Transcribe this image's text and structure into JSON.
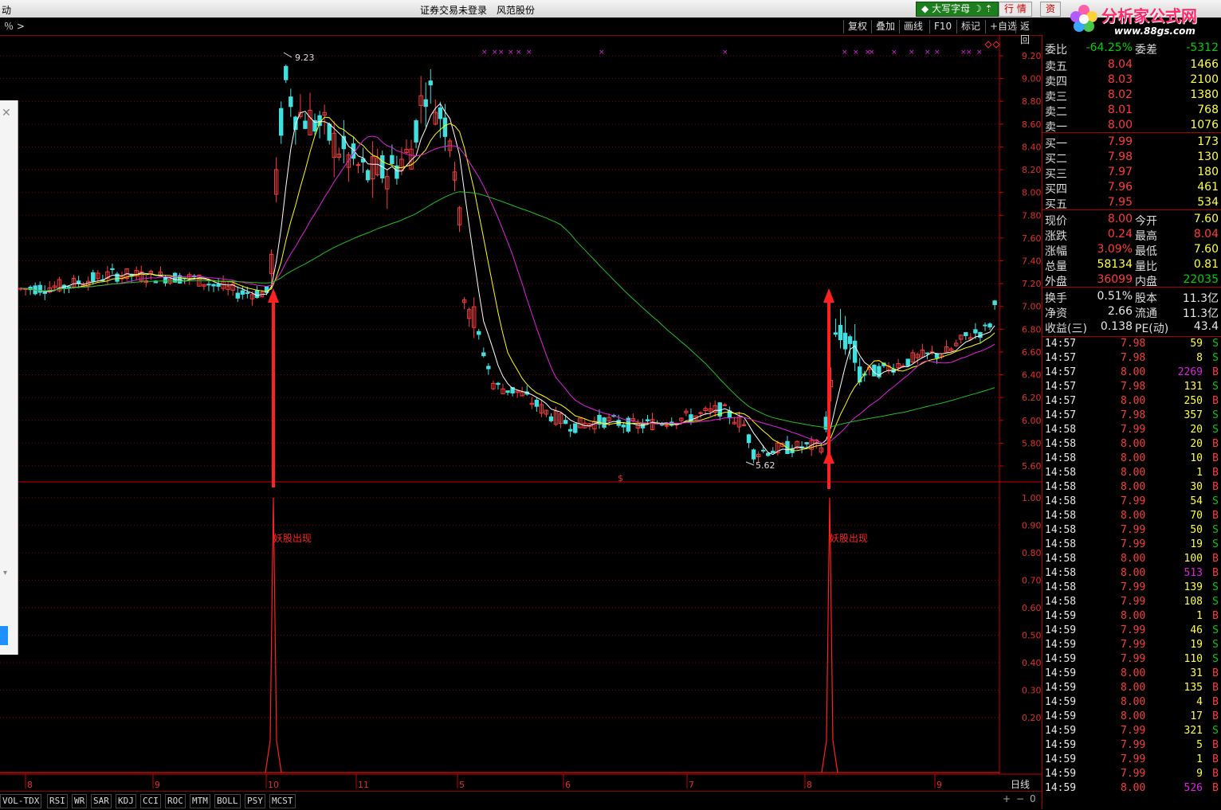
{
  "titlebar": {
    "left_text": "动",
    "center1": "证券交易未登录",
    "center2": "风范股份",
    "btn_daxie": "大写字母",
    "btn_hangqing": "行 情",
    "btn_zi": "资"
  },
  "logo": {
    "name": "分析家公式网",
    "url": "www.88gs.com"
  },
  "toolbar": {
    "left": "％ >",
    "items": [
      "复权",
      "叠加",
      "画线",
      "F10",
      "标记",
      "+自选",
      "返回"
    ]
  },
  "main": {
    "price_high_label": "9.23",
    "price_low_label": "5.62",
    "annotation_1": "妖股出现",
    "annotation_2": "妖股出现",
    "mid_marker": "$",
    "price_ticks": [
      "9.20",
      "9.00",
      "8.80",
      "8.60",
      "8.40",
      "8.20",
      "8.00",
      "7.80",
      "7.60",
      "7.40",
      "7.20",
      "7.00",
      "6.80",
      "6.60",
      "6.40",
      "6.20",
      "6.00",
      "5.80",
      "5.60"
    ],
    "ind_ticks": [
      "1.00",
      "0.90",
      "0.80",
      "0.70",
      "0.60",
      "0.50",
      "0.40",
      "0.30",
      "0.20"
    ],
    "date_labels": [
      "8",
      "9",
      "10",
      "11",
      "5",
      "6",
      "7",
      "8",
      "9"
    ],
    "period": "日线"
  },
  "quote": {
    "weibi_label": "委比",
    "weibi": "-64.25%",
    "weicha_label": "委差",
    "weicha": "-5312",
    "asks": [
      {
        "label": "卖五",
        "price": "8.04",
        "vol": "1466"
      },
      {
        "label": "卖四",
        "price": "8.03",
        "vol": "2100"
      },
      {
        "label": "卖三",
        "price": "8.02",
        "vol": "1380"
      },
      {
        "label": "卖二",
        "price": "8.01",
        "vol": "768"
      },
      {
        "label": "卖一",
        "price": "8.00",
        "vol": "1076"
      }
    ],
    "bids": [
      {
        "label": "买一",
        "price": "7.99",
        "vol": "173"
      },
      {
        "label": "买二",
        "price": "7.98",
        "vol": "130"
      },
      {
        "label": "买三",
        "price": "7.97",
        "vol": "180"
      },
      {
        "label": "买四",
        "price": "7.96",
        "vol": "461"
      },
      {
        "label": "买五",
        "price": "7.95",
        "vol": "534"
      }
    ],
    "stats": [
      {
        "l1": "现价",
        "v1": "8.00",
        "l2": "今开",
        "v2": "7.60"
      },
      {
        "l1": "涨跌",
        "v1": "0.24",
        "l2": "最高",
        "v2": "8.04"
      },
      {
        "l1": "涨幅",
        "v1": "3.09%",
        "l2": "最低",
        "v2": "7.60"
      },
      {
        "l1": "总量",
        "v1": "58134",
        "l2": "量比",
        "v2": "0.81"
      },
      {
        "l1": "外盘",
        "v1": "36099",
        "l2": "内盘",
        "v2": "22035"
      }
    ],
    "stats2": [
      {
        "l1": "换手",
        "v1": "0.51%",
        "l2": "股本",
        "v2": "11.3亿"
      },
      {
        "l1": "净资",
        "v1": "2.66",
        "l2": "流通",
        "v2": "11.3亿"
      },
      {
        "l1": "收益(三)",
        "v1": "0.138",
        "l2": "PE(动)",
        "v2": "43.4"
      }
    ]
  },
  "ticks": [
    [
      "14:57",
      "7.98",
      "59",
      "S"
    ],
    [
      "14:57",
      "7.98",
      "8",
      "S"
    ],
    [
      "14:57",
      "8.00",
      "2269",
      "B"
    ],
    [
      "14:57",
      "7.98",
      "131",
      "S"
    ],
    [
      "14:57",
      "8.00",
      "250",
      "B"
    ],
    [
      "14:57",
      "7.98",
      "357",
      "S"
    ],
    [
      "14:58",
      "7.99",
      "20",
      "S"
    ],
    [
      "14:58",
      "8.00",
      "20",
      "B"
    ],
    [
      "14:58",
      "8.00",
      "10",
      "B"
    ],
    [
      "14:58",
      "8.00",
      "1",
      "B"
    ],
    [
      "14:58",
      "8.00",
      "30",
      "B"
    ],
    [
      "14:58",
      "7.99",
      "54",
      "S"
    ],
    [
      "14:58",
      "8.00",
      "70",
      "B"
    ],
    [
      "14:58",
      "7.99",
      "50",
      "S"
    ],
    [
      "14:58",
      "7.99",
      "19",
      "S"
    ],
    [
      "14:58",
      "8.00",
      "100",
      "B"
    ],
    [
      "14:58",
      "8.00",
      "513",
      "B"
    ],
    [
      "14:58",
      "7.99",
      "139",
      "S"
    ],
    [
      "14:58",
      "7.99",
      "108",
      "S"
    ],
    [
      "14:59",
      "8.00",
      "1",
      "B"
    ],
    [
      "14:59",
      "7.99",
      "46",
      "S"
    ],
    [
      "14:59",
      "7.99",
      "19",
      "S"
    ],
    [
      "14:59",
      "7.99",
      "110",
      "S"
    ],
    [
      "14:59",
      "8.00",
      "31",
      "B"
    ],
    [
      "14:59",
      "8.00",
      "135",
      "B"
    ],
    [
      "14:59",
      "8.00",
      "4",
      "B"
    ],
    [
      "14:59",
      "8.00",
      "17",
      "B"
    ],
    [
      "14:59",
      "7.99",
      "321",
      "S"
    ],
    [
      "14:59",
      "7.99",
      "5",
      "B"
    ],
    [
      "14:59",
      "7.99",
      "1",
      "B"
    ],
    [
      "14:59",
      "7.99",
      "9",
      "B"
    ],
    [
      "14:59",
      "8.00",
      "526",
      "B"
    ]
  ],
  "bottom_tabs": [
    "VOL-TDX",
    "RSI",
    "WR",
    "SAR",
    "KDJ",
    "CCI",
    "ROC",
    "MTM",
    "BOLL",
    "PSY",
    "MCST"
  ],
  "bottom_right": [
    "+",
    "−",
    "0"
  ],
  "colors": {
    "up": "#ff3b3b",
    "down": "#40e0e0",
    "ma5": "#ffffff",
    "ma10": "#ffff00",
    "ma20": "#e020e0",
    "ma60": "#20c020",
    "grid": "#8b0000"
  }
}
